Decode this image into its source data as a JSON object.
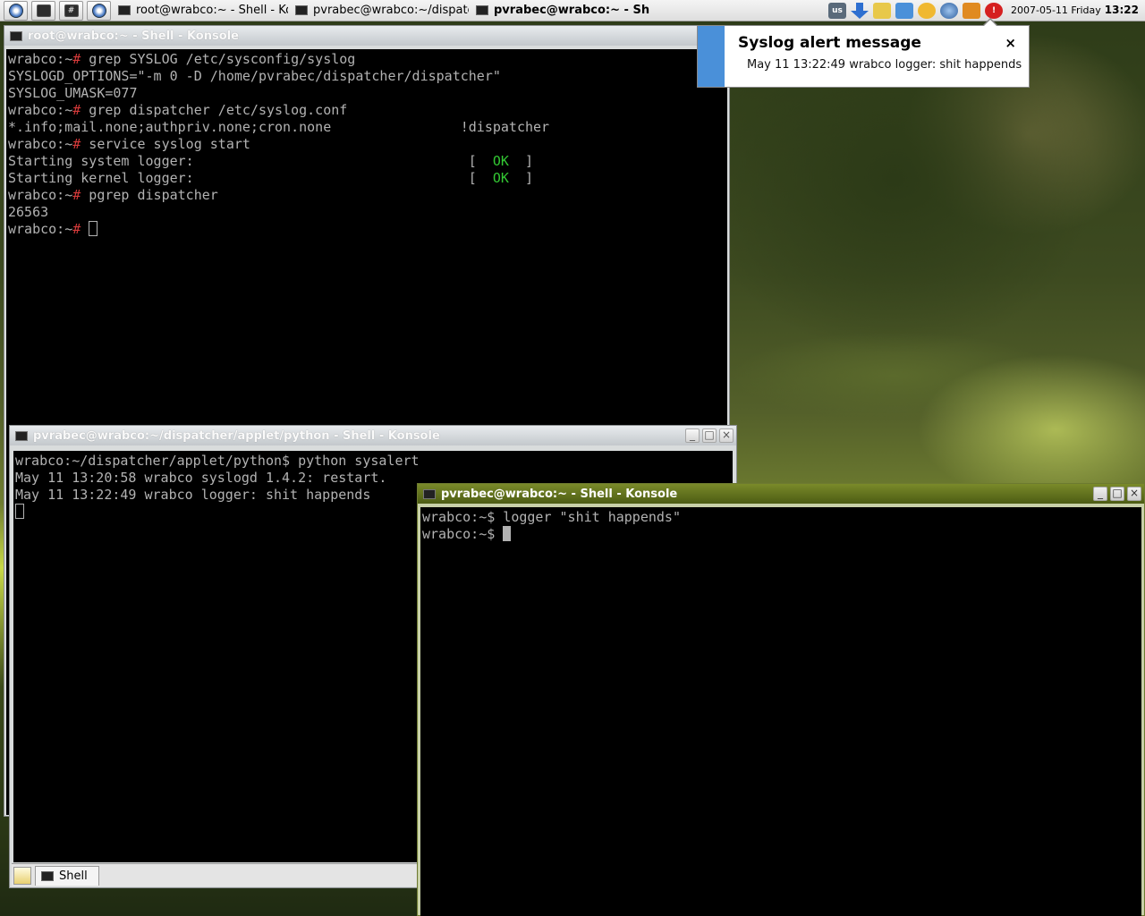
{
  "taskbar": {
    "launchers": [
      {
        "icon": "kmenu-icon"
      },
      {
        "icon": "desktop-icon"
      },
      {
        "icon": "control-center-icon"
      },
      {
        "icon": "browser-icon"
      }
    ],
    "tasks": [
      {
        "label": "root@wrabco:~ - Shell - Kon",
        "active": false
      },
      {
        "label": "pvrabec@wrabco:~/dispatc",
        "active": false
      },
      {
        "label": "pvrabec@wrabco:~ - Sh",
        "active": true
      }
    ],
    "tray": {
      "keyboard_layout": "us",
      "icons": [
        "download-arrow-icon",
        "klipper-icon",
        "network-icon",
        "updater-icon",
        "globe-icon",
        "folder-icon",
        "alert-icon"
      ]
    },
    "clock": {
      "date": "2007-05-11 Friday",
      "time": "13:22"
    }
  },
  "windows": {
    "root": {
      "title": "root@wrabco:~ - Shell - Konsole",
      "lines": [
        {
          "prompt": "wrabco:~",
          "sym": "#",
          "text": " grep SYSLOG /etc/sysconfig/syslog"
        },
        {
          "text": "SYSLOGD_OPTIONS=\"-m 0 -D /home/pvrabec/dispatcher/dispatcher\""
        },
        {
          "text": "SYSLOG_UMASK=077"
        },
        {
          "prompt": "wrabco:~",
          "sym": "#",
          "text": " grep dispatcher /etc/syslog.conf"
        },
        {
          "text": "*.info;mail.none;authpriv.none;cron.none                !dispatcher"
        },
        {
          "prompt": "wrabco:~",
          "sym": "#",
          "text": " service syslog start"
        },
        {
          "text": "Starting system logger:                                  [  ",
          "ok": "OK",
          "after": "  ]"
        },
        {
          "text": "Starting kernel logger:                                  [  ",
          "ok": "OK",
          "after": "  ]"
        },
        {
          "prompt": "wrabco:~",
          "sym": "#",
          "text": " pgrep dispatcher"
        },
        {
          "text": "26563"
        },
        {
          "prompt": "wrabco:~",
          "sym": "#",
          "text": " ",
          "cursor": "hollow"
        }
      ]
    },
    "python": {
      "title": "pvrabec@wrabco:~/dispatcher/applet/python - Shell - Konsole",
      "lines": [
        {
          "prompt": "wrabco:~/dispatcher/applet/python",
          "sym": "$",
          "text": " python sysalert"
        },
        {
          "text": "May 11 13:20:58 wrabco syslogd 1.4.2: restart."
        },
        {
          "text": "May 11 13:22:49 wrabco logger: shit happends"
        },
        {
          "text": "",
          "cursor": "hollow"
        }
      ],
      "tab_label": "Shell"
    },
    "user": {
      "title": "pvrabec@wrabco:~ - Shell - Konsole",
      "lines": [
        {
          "prompt": "wrabco:~",
          "sym": "$",
          "text": " logger \"shit happends\""
        },
        {
          "prompt": "wrabco:~",
          "sym": "$",
          "text": " ",
          "cursor": "solid"
        }
      ]
    }
  },
  "notification": {
    "title": "Syslog alert message",
    "message": "May 11 13:22:49 wrabco logger: shit happends",
    "close_glyph": "×",
    "accent_color": "#4a90d9"
  },
  "window_buttons": {
    "minimize": "_",
    "maximize": "□",
    "close": "×"
  }
}
